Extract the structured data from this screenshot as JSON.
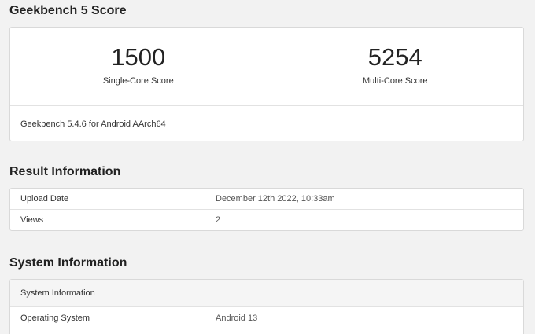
{
  "score_section": {
    "title": "Geekbench 5 Score",
    "single_core_value": "1500",
    "single_core_label": "Single-Core Score",
    "multi_core_value": "5254",
    "multi_core_label": "Multi-Core Score",
    "version": "Geekbench 5.4.6 for Android AArch64"
  },
  "result_section": {
    "title": "Result Information",
    "rows": [
      {
        "key": "Upload Date",
        "value": "December 12th 2022, 10:33am"
      },
      {
        "key": "Views",
        "value": "2"
      }
    ]
  },
  "system_section": {
    "title": "System Information",
    "header": "System Information",
    "rows": [
      {
        "key": "Operating System",
        "value": "Android 13"
      }
    ]
  }
}
